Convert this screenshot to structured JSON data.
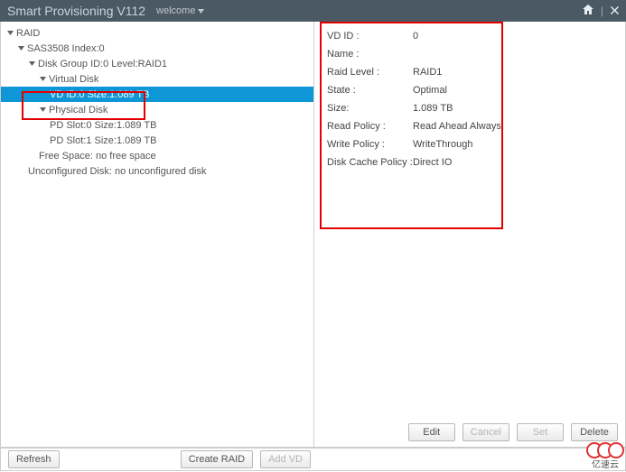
{
  "header": {
    "title": "Smart Provisioning V112",
    "welcome": "welcome"
  },
  "tree": {
    "root": "RAID",
    "controller": "SAS3508 Index:0",
    "diskgroup": "Disk Group ID:0 Level:RAID1",
    "virtualdisk_hdr": "Virtual Disk",
    "virtualdisk_item": "VD ID:0 Size:1.089 TB",
    "physicaldisk_hdr": "Physical Disk",
    "pd0": "PD Slot:0 Size:1.089 TB",
    "pd1": "PD Slot:1 Size:1.089 TB",
    "freespace": "Free Space: no free space",
    "unconfigured": "Unconfigured Disk: no unconfigured disk"
  },
  "details": {
    "vdid_label": "VD ID :",
    "vdid_val": "0",
    "name_label": "Name :",
    "name_val": "",
    "raid_label": "Raid Level :",
    "raid_val": "RAID1",
    "state_label": "State :",
    "state_val": "Optimal",
    "size_label": "Size:",
    "size_val": "1.089 TB",
    "read_label": "Read Policy :",
    "read_val": "Read Ahead Always",
    "write_label": "Write Policy :",
    "write_val": "WriteThrough",
    "cache_label": "Disk Cache Policy :",
    "cache_val": "Direct IO"
  },
  "buttons": {
    "edit": "Edit",
    "cancel": "Cancel",
    "set": "Set",
    "delete": "Delete",
    "refresh": "Refresh",
    "create": "Create RAID",
    "addvd": "Add VD"
  },
  "watermark": "亿速云"
}
